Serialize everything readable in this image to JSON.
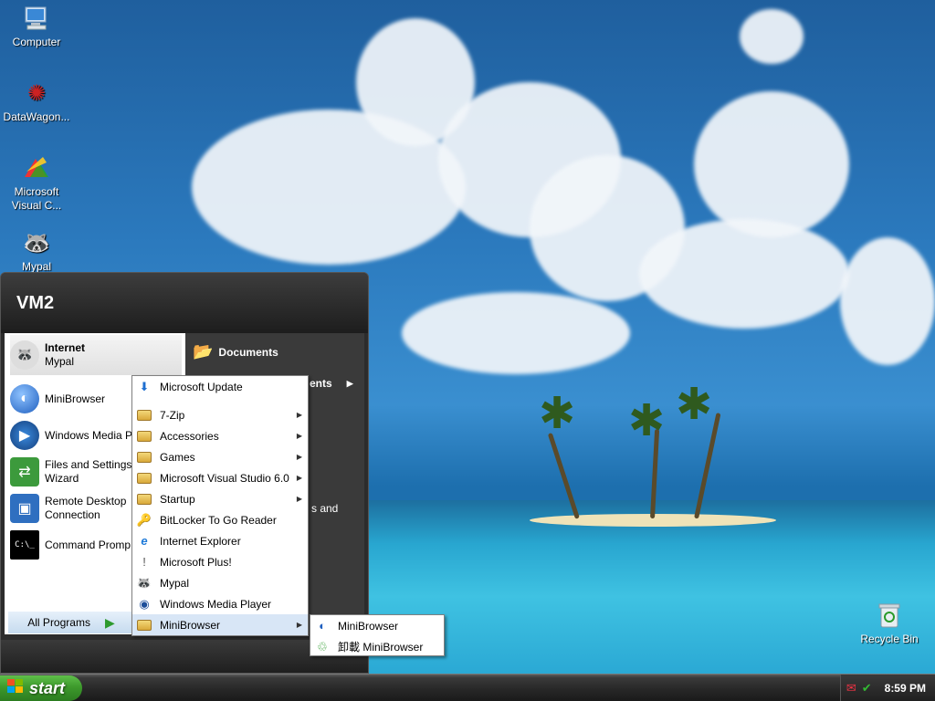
{
  "desktop": {
    "icons": [
      {
        "label": "Computer",
        "icon": "computer-icon"
      },
      {
        "label": "DataWagon...",
        "icon": "datawagon-icon"
      },
      {
        "label": "Microsoft Visual C...",
        "icon": "visual-c-icon"
      },
      {
        "label": "Mypal",
        "icon": "mypal-icon"
      }
    ],
    "recycle_bin": {
      "label": "Recycle Bin",
      "icon": "recycle-bin-icon"
    }
  },
  "start_menu": {
    "user": "VM2",
    "pinned": [
      {
        "title": "Internet",
        "subtitle": "Mypal",
        "icon": "mypal-icon"
      },
      {
        "title": "MiniBrowser",
        "subtitle": "",
        "icon": "minibrowser-icon"
      },
      {
        "title": "Windows Media Pl",
        "subtitle": "",
        "icon": "media-player-icon"
      },
      {
        "title": "Files and Settings",
        "subtitle": "Wizard",
        "icon": "transfer-wizard-icon"
      },
      {
        "title": "Remote Desktop",
        "subtitle": "Connection",
        "icon": "remote-desktop-icon"
      },
      {
        "title": "Command Promp",
        "subtitle": "",
        "icon": "command-prompt-icon"
      }
    ],
    "all_programs": "All Programs",
    "right": {
      "documents": "Documents",
      "recent": "ents",
      "settings": "s and"
    }
  },
  "programs_menu": {
    "items": [
      {
        "label": "Microsoft Update",
        "icon": "update-icon",
        "submenu": false
      },
      {
        "label": "7-Zip",
        "icon": "folder-icon",
        "submenu": true
      },
      {
        "label": "Accessories",
        "icon": "folder-icon",
        "submenu": true
      },
      {
        "label": "Games",
        "icon": "folder-icon",
        "submenu": true
      },
      {
        "label": "Microsoft Visual Studio 6.0",
        "icon": "folder-icon",
        "submenu": true
      },
      {
        "label": "Startup",
        "icon": "folder-icon",
        "submenu": true
      },
      {
        "label": "BitLocker To Go Reader",
        "icon": "bitlocker-icon",
        "submenu": false
      },
      {
        "label": "Internet Explorer",
        "icon": "ie-icon",
        "submenu": false
      },
      {
        "label": "Microsoft Plus!",
        "icon": "plus-icon",
        "submenu": false
      },
      {
        "label": "Mypal",
        "icon": "mypal-icon",
        "submenu": false
      },
      {
        "label": "Windows Media Player",
        "icon": "media-player-icon",
        "submenu": false
      },
      {
        "label": "MiniBrowser",
        "icon": "folder-icon",
        "submenu": true
      }
    ]
  },
  "minibrowser_menu": {
    "items": [
      {
        "label": "MiniBrowser",
        "icon": "minibrowser-icon"
      },
      {
        "label": "卸載 MiniBrowser",
        "icon": "uninstall-icon"
      }
    ]
  },
  "taskbar": {
    "start_label": "start",
    "clock": "8:59 PM"
  },
  "colors": {
    "start_green": "#3d9a2c",
    "menu_highlight": "#d8e6f6",
    "start_menu_dark": "#2c2c2c"
  }
}
